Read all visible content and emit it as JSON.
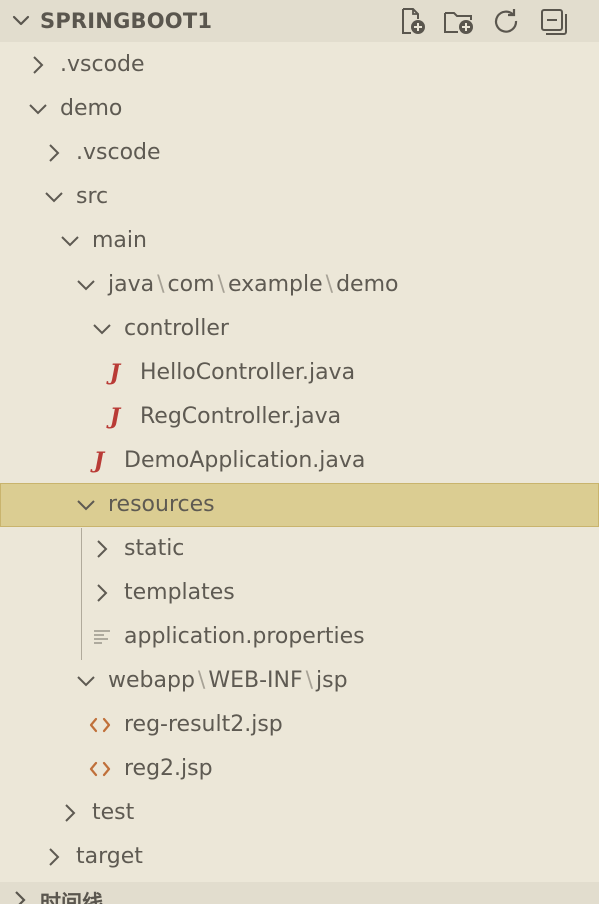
{
  "explorer": {
    "title": "SPRINGBOOT1",
    "actions": [
      {
        "name": "new-file",
        "icon": "new-file-icon"
      },
      {
        "name": "new-folder",
        "icon": "new-folder-icon"
      },
      {
        "name": "refresh",
        "icon": "refresh-icon"
      },
      {
        "name": "collapse-all",
        "icon": "collapse-all-icon"
      }
    ]
  },
  "tree": [
    {
      "label": ".vscode",
      "kind": "folder",
      "expanded": false,
      "depth": 0
    },
    {
      "label": "demo",
      "kind": "folder",
      "expanded": true,
      "depth": 0
    },
    {
      "label": ".vscode",
      "kind": "folder",
      "expanded": false,
      "depth": 1
    },
    {
      "label": "src",
      "kind": "folder",
      "expanded": true,
      "depth": 1
    },
    {
      "label": "main",
      "kind": "folder",
      "expanded": true,
      "depth": 2
    },
    {
      "label_parts": [
        "java",
        "com",
        "example",
        "demo"
      ],
      "kind": "folder",
      "expanded": true,
      "depth": 3
    },
    {
      "label": "controller",
      "kind": "folder",
      "expanded": true,
      "depth": 4
    },
    {
      "label": "HelloController.java",
      "kind": "java",
      "depth": 5
    },
    {
      "label": "RegController.java",
      "kind": "java",
      "depth": 5
    },
    {
      "label": "DemoApplication.java",
      "kind": "java",
      "depth": 4
    },
    {
      "label": "resources",
      "kind": "folder",
      "expanded": true,
      "depth": 3,
      "selected": true
    },
    {
      "label": "static",
      "kind": "folder",
      "expanded": false,
      "depth": 4
    },
    {
      "label": "templates",
      "kind": "folder",
      "expanded": false,
      "depth": 4
    },
    {
      "label": "application.properties",
      "kind": "properties",
      "depth": 4
    },
    {
      "label_parts": [
        "webapp",
        "WEB-INF",
        "jsp"
      ],
      "kind": "folder",
      "expanded": true,
      "depth": 3
    },
    {
      "label": "reg-result2.jsp",
      "kind": "jsp",
      "depth": 4
    },
    {
      "label": "reg2.jsp",
      "kind": "jsp",
      "depth": 4
    },
    {
      "label": "test",
      "kind": "folder",
      "expanded": false,
      "depth": 2
    },
    {
      "label": "target",
      "kind": "folder",
      "expanded": false,
      "depth": 1
    }
  ],
  "path_separator": "\\",
  "icons": {
    "java_glyph": "J"
  },
  "colors": {
    "background": "#ece7d8",
    "header_background": "#e2ddce",
    "selected_background": "#dbcd92",
    "selected_border": "#c9b46d",
    "text": "#5e5a52",
    "java_icon": "#b93b36",
    "jsp_icon": "#c0703a"
  },
  "bottom_section": {
    "title": "时间线"
  }
}
